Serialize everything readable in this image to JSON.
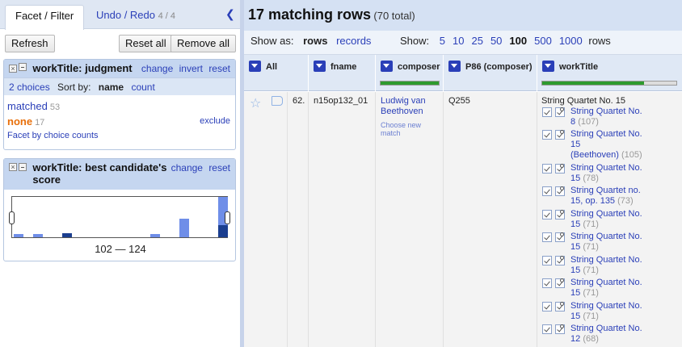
{
  "left_panel": {
    "tabs": {
      "facet_filter": "Facet / Filter",
      "undo_redo": "Undo / Redo",
      "undo_count": "4 / 4"
    },
    "buttons": {
      "refresh": "Refresh",
      "reset_all": "Reset all",
      "remove_all": "Remove all"
    },
    "facet_judgment": {
      "title": "workTitle: judgment",
      "links": {
        "change": "change",
        "invert": "invert",
        "reset": "reset"
      },
      "choices_summary": "2 choices",
      "sort_by_label": "Sort by:",
      "sort_name": "name",
      "sort_count": "count",
      "choices": [
        {
          "label": "matched",
          "count": "53"
        },
        {
          "label": "none",
          "count": "17",
          "action": "exclude"
        }
      ],
      "footer": "Facet by choice counts"
    },
    "facet_score": {
      "title": "workTitle: best candidate's score",
      "links": {
        "change": "change",
        "reset": "reset"
      },
      "range_text": "102 — 124",
      "histogram_bins": [
        {
          "level": 0.07,
          "selected": false
        },
        {
          "level": 0.07,
          "selected": false
        },
        {
          "level": 0.1,
          "selected": true
        },
        {
          "level": 0.07,
          "selected": false
        },
        {
          "level": 0.45,
          "selected": false
        },
        {
          "level": 1.0,
          "selected": false
        },
        {
          "level": 0.3,
          "selected": true
        }
      ]
    }
  },
  "right_panel": {
    "summary": {
      "matching": "17 matching rows",
      "total": "(70 total)"
    },
    "view": {
      "show_as_label": "Show as:",
      "rows": "rows",
      "records": "records",
      "show_label": "Show:",
      "page_sizes": [
        "5",
        "10",
        "25",
        "50",
        "100",
        "500",
        "1000"
      ],
      "selected_size": "100",
      "rows_suffix": "rows"
    },
    "columns": [
      {
        "name": "All"
      },
      {
        "name": "fname"
      },
      {
        "name": "composer",
        "matched_fraction": 1.0
      },
      {
        "name": "P86 (composer)"
      },
      {
        "name": "workTitle",
        "matched_fraction": 0.76
      }
    ],
    "row": {
      "index": "62.",
      "fname": "n15op132_01",
      "composer": "Ludwig van Beethoven",
      "choose_new_match": "Choose new match",
      "p86": "Q255",
      "workTitle": "String Quartet No. 15",
      "candidates": [
        {
          "line1": "String Quartet No.",
          "line2": "8",
          "score": "(107)"
        },
        {
          "line1": "String Quartet No.",
          "line2": "15",
          "line3": "(Beethoven)",
          "score": "(105)"
        },
        {
          "line1": "String Quartet No.",
          "line2": "15",
          "score": "(78)"
        },
        {
          "line1": "String Quartet no.",
          "line2": "15, op. 135",
          "score": "(73)"
        },
        {
          "line1": "String Quartet No.",
          "line2": "15",
          "score": "(71)"
        },
        {
          "line1": "String Quartet No.",
          "line2": "15",
          "score": "(71)"
        },
        {
          "line1": "String Quartet No.",
          "line2": "15",
          "score": "(71)"
        },
        {
          "line1": "String Quartet No.",
          "line2": "15",
          "score": "(71)"
        },
        {
          "line1": "String Quartet No.",
          "line2": "15",
          "score": "(71)"
        },
        {
          "line1": "String Quartet No.",
          "line2": "12",
          "score": "(68)"
        }
      ]
    }
  }
}
